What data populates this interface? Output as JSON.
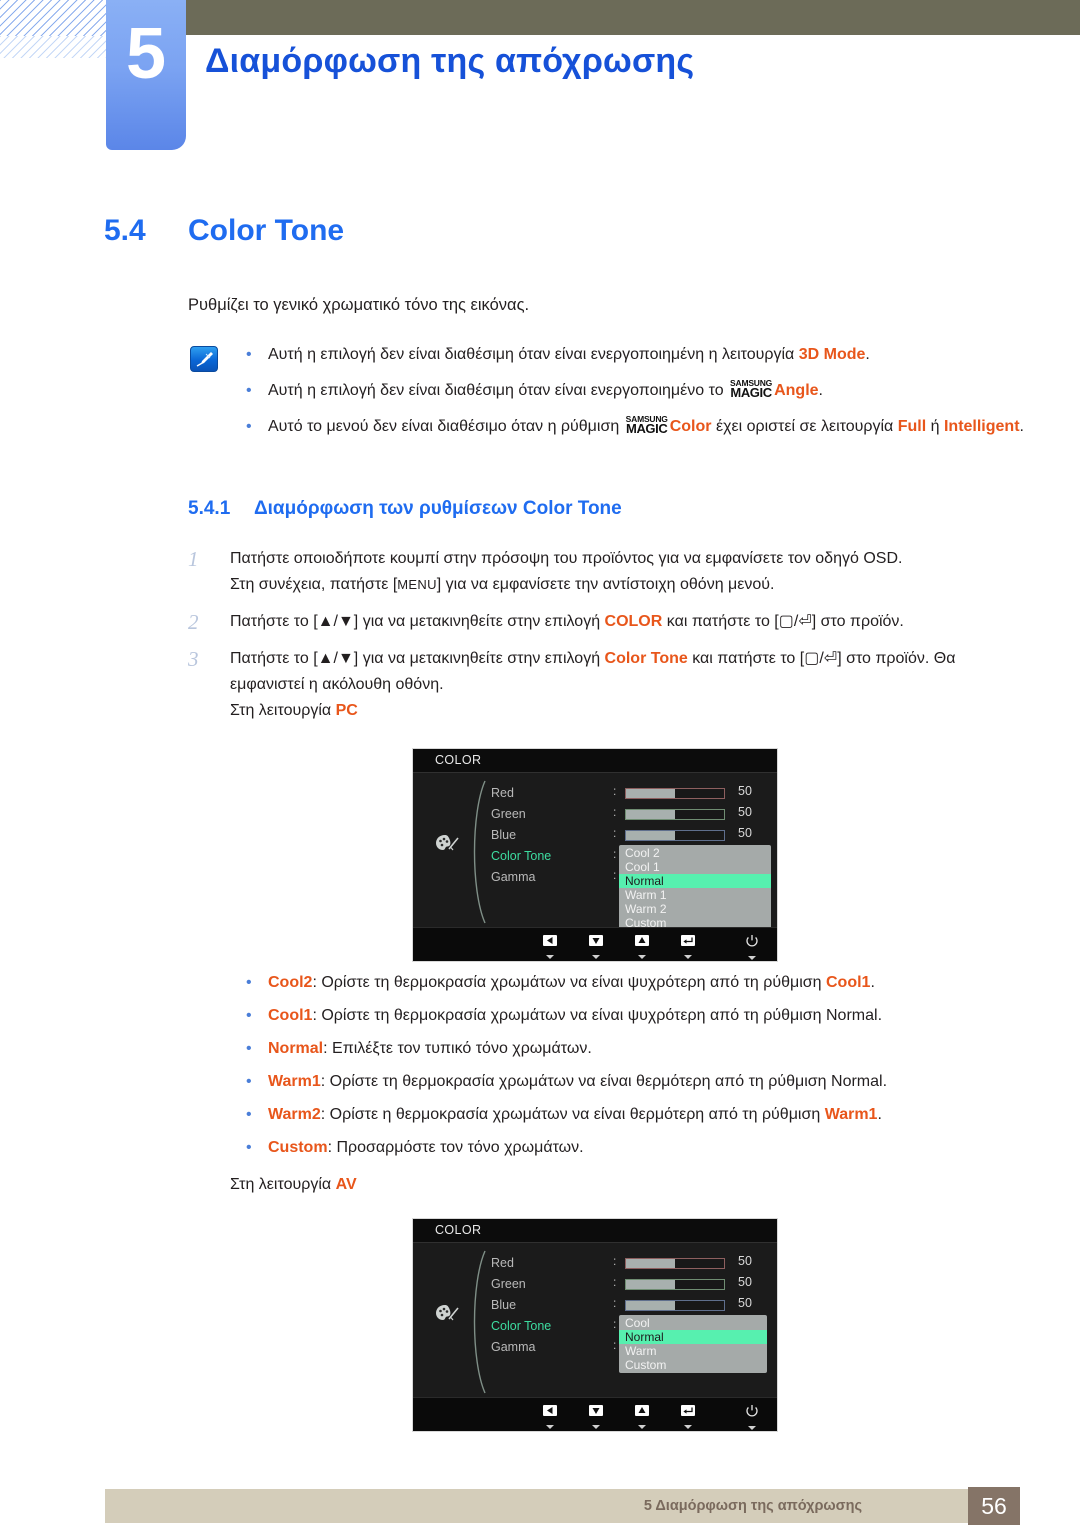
{
  "header": {
    "chapter_number": "5",
    "chapter_title": "Διαμόρφωση της απόχρωσης",
    "accent_blue": "#1651d8",
    "olive": "#6c6b58"
  },
  "section": {
    "number": "5.4",
    "title": "Color Tone",
    "intro": "Ρυθμίζει το γενικό χρωματικό τόνο της εικόνας."
  },
  "note": {
    "icon": "note-pen-icon",
    "items": [
      {
        "pre": "Αυτή η επιλογή δεν είναι διαθέσιμη όταν είναι ενεργοποιημένη η λειτουργία ",
        "accent1": "3D Mode",
        "mid": ".",
        "magic": false,
        "accent2": "",
        "post": ""
      },
      {
        "pre": "Αυτή η επιλογή δεν είναι διαθέσιμη όταν είναι ενεργοποιημένο το ",
        "accent1": "",
        "mid": "",
        "magic": true,
        "accent2": "Angle",
        "post": "."
      },
      {
        "pre": "Αυτό το μενού δεν είναι διαθέσιμο όταν η ρύθμιση ",
        "accent1": "",
        "mid": "",
        "magic": true,
        "accent2": "Color",
        "post": " έχει οριστεί σε λειτουργία ",
        "accent3": "Full",
        "post2": " ή ",
        "accent4": "Intelligent",
        "post3": "."
      }
    ],
    "magic_logo": {
      "line1": "SAMSUNG",
      "line2": "MAGIC"
    }
  },
  "subsection": {
    "number": "5.4.1",
    "title": "Διαμόρφωση των ρυθμίσεων Color Tone"
  },
  "steps": [
    {
      "n": "1",
      "t1": "Πατήστε οποιοδήποτε κουμπί στην πρόσοψη του προϊόντος για να εμφανίσετε τον οδηγό OSD.",
      "t2_pre": "Στη συνέχεια, πατήστε [",
      "key": "MENU",
      "t2_post": "] για να εμφανίσετε την αντίστοιχη οθόνη μενού."
    },
    {
      "n": "2",
      "pre": "Πατήστε το [▲/▼] για να μετακινηθείτε στην επιλογή ",
      "accent": "COLOR",
      "post": " και πατήστε το [▢/⏎] στο προϊόν."
    },
    {
      "n": "3",
      "pre": "Πατήστε το [▲/▼] για να μετακινηθείτε στην επιλογή ",
      "accent": "Color Tone",
      "post": " και πατήστε το [▢/⏎] στο προϊόν. Θα εμφανιστεί η ακόλουθη οθόνη."
    }
  ],
  "mode_pc": {
    "pre": "Στη λειτουργία ",
    "accent": "PC"
  },
  "mode_av": {
    "pre": "Στη λειτουργία ",
    "accent": "AV"
  },
  "osd_pc": {
    "title": "COLOR",
    "items": [
      "Red",
      "Green",
      "Blue",
      "Color Tone",
      "Gamma"
    ],
    "selected_item": "Color Tone",
    "values": [
      "50",
      "50",
      "50"
    ],
    "slider_percent": 49,
    "dropdown": [
      "Cool 2",
      "Cool 1",
      "Normal",
      "Warm 1",
      "Warm 2",
      "Custom"
    ],
    "dropdown_highlight": "Normal",
    "footer_icons": [
      "left-triangle-icon",
      "down-triangle-icon",
      "up-triangle-icon",
      "enter-icon",
      "power-icon"
    ],
    "highlight_color": "#57f0af",
    "selected_color": "#3ddca0"
  },
  "osd_av": {
    "title": "COLOR",
    "items": [
      "Red",
      "Green",
      "Blue",
      "Color Tone",
      "Gamma"
    ],
    "selected_item": "Color Tone",
    "values": [
      "50",
      "50",
      "50"
    ],
    "slider_percent": 49,
    "dropdown": [
      "Cool",
      "Normal",
      "Warm",
      "Custom"
    ],
    "dropdown_highlight": "Normal",
    "footer_icons": [
      "left-triangle-icon",
      "down-triangle-icon",
      "up-triangle-icon",
      "enter-icon",
      "power-icon"
    ],
    "highlight_color": "#57f0af",
    "selected_color": "#3ddca0"
  },
  "tone_bullets": [
    {
      "term": "Cool2",
      "sep": ": ",
      "pre": "Ορίστε τη θερμοκρασία χρωμάτων να είναι ψυχρότερη από τη ρύθμιση ",
      "accent": "Cool1",
      "post": "."
    },
    {
      "term": "Cool1",
      "sep": ": ",
      "pre": "Ορίστε τη θερμοκρασία χρωμάτων να είναι ψυχρότερη από τη ρύθμιση Normal.",
      "accent": "",
      "post": ""
    },
    {
      "term": "Normal",
      "sep": ": ",
      "pre": "Επιλέξτε τον τυπικό τόνο χρωμάτων.",
      "accent": "",
      "post": ""
    },
    {
      "term": "Warm1",
      "sep": ": ",
      "pre": "Ορίστε τη θερμοκρασία χρωμάτων να είναι θερμότερη από τη ρύθμιση Normal.",
      "accent": "",
      "post": ""
    },
    {
      "term": "Warm2",
      "sep": ": ",
      "pre": "Ορίστε η θερμοκρασία χρωμάτων να είναι θερμότερη από τη ρύθμιση ",
      "accent": "Warm1",
      "post": "."
    },
    {
      "term": "Custom",
      "sep": ": ",
      "pre": "Προσαρμόστε τον τόνο χρωμάτων.",
      "accent": "",
      "post": ""
    }
  ],
  "footer": {
    "text": "5 Διαμόρφωση της απόχρωσης",
    "page": "56",
    "bar_color": "#d4cdba",
    "page_box_color": "#857467"
  }
}
